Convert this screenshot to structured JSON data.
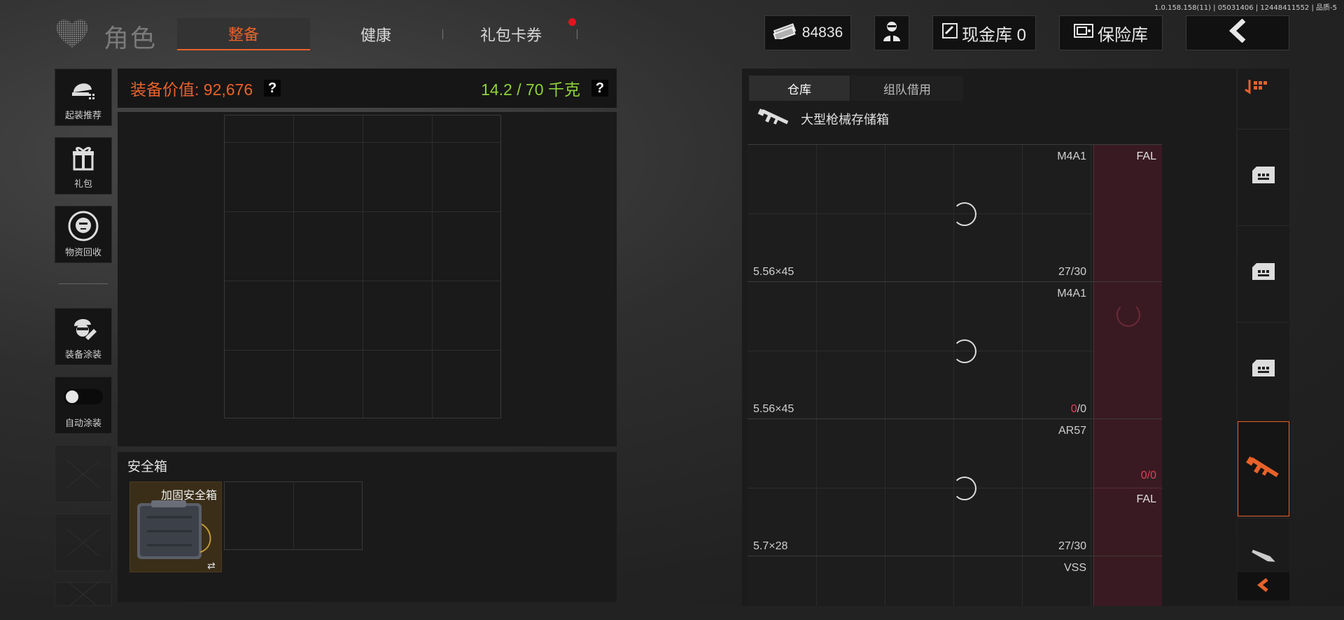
{
  "version": "1.0.158.158(11) | 05031406 | 12448411552 | 品质-5",
  "header": {
    "title": "角色",
    "tabs": [
      {
        "label": "整备",
        "active": true
      },
      {
        "label": "健康",
        "active": false
      },
      {
        "label": "礼包卡券",
        "active": false,
        "notification": true
      }
    ],
    "currency_amount": "84836",
    "vault_label": "现金库 0",
    "safe_label": "保险库",
    "accent_color": "#e8622a",
    "icons": [
      "cash-icon",
      "agent-icon",
      "vault-icon",
      "safe-icon",
      "back-arrow-icon"
    ]
  },
  "sidebar": {
    "items": [
      {
        "label": "起装推荐",
        "icon": "helmet-gear-icon"
      },
      {
        "label": "礼包",
        "icon": "gift-icon"
      },
      {
        "label": "物资回收",
        "icon": "recycle-icon"
      },
      {
        "label": "装备涂装",
        "icon": "soldier-paint-icon"
      },
      {
        "label": "自动涂装",
        "icon": "toggle-switch",
        "toggle_on": false
      }
    ]
  },
  "equipment": {
    "value_label": "装备价值: 92,676",
    "weight_label": "14.2 / 70 千克",
    "help_glyph": "?",
    "secure_title": "安全箱",
    "secure_case_name": "加固安全箱",
    "swap_glyph": "⇄"
  },
  "storage": {
    "tabs": [
      {
        "label": "仓库",
        "active": true
      },
      {
        "label": "组队借用",
        "active": false
      }
    ],
    "container_name": "大型枪械存储箱",
    "rows": [
      {
        "gun": "M4A1",
        "ammo": "5.56×45",
        "count_a": "",
        "count_b": "27/30",
        "side_gun": "FAL",
        "side_count": ""
      },
      {
        "gun": "M4A1",
        "ammo": "5.56×45",
        "count_a": "0",
        "count_b": "/0",
        "side_gun": "",
        "side_count": ""
      },
      {
        "gun": "AR57",
        "ammo": "5.7×28",
        "count_a": "",
        "count_b": "27/30",
        "side_gun": "FAL",
        "side_count": "0/0"
      },
      {
        "gun": "VSS",
        "ammo": "",
        "count_a": "",
        "count_b": "",
        "side_gun": "",
        "side_count": ""
      }
    ]
  },
  "categories": [
    "sort-icon",
    "ammo-crate-icon",
    "ammo-crate-icon",
    "ammo-crate-icon",
    "rifle-icon",
    "knife-icon"
  ]
}
